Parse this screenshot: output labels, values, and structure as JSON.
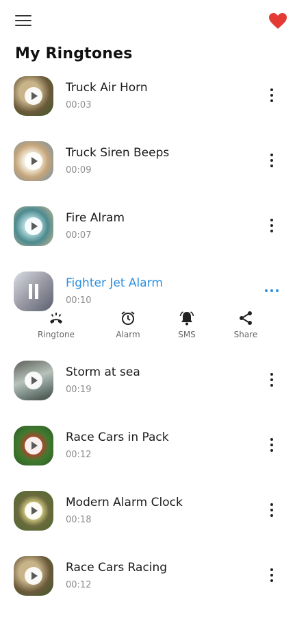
{
  "header": {
    "menu_icon": "hamburger-menu-icon",
    "favorite_icon": "heart-icon",
    "title": "My Ringtones",
    "colors": {
      "heart": "#e53935",
      "accent": "#2b8fe0"
    }
  },
  "ringtones": [
    {
      "title": "Truck Air Horn",
      "duration": "00:03",
      "thumb": "#6b5a3a"
    },
    {
      "title": "Truck Siren Beeps",
      "duration": "00:09",
      "thumb": "#c6a57a"
    },
    {
      "title": "Fire Alram",
      "duration": "00:07",
      "thumb": "#4d8a8f"
    },
    {
      "title": "Fighter Jet Alarm",
      "duration": "00:10",
      "thumb": "#9a9aa5",
      "active": true
    },
    {
      "title": "Storm at sea",
      "duration": "00:19",
      "thumb": "#7c8b86"
    },
    {
      "title": "Race Cars in Pack",
      "duration": "00:12",
      "thumb": "#3f7a2f"
    },
    {
      "title": "Modern Alarm Clock",
      "duration": "00:18",
      "thumb": "#6b6a3d"
    },
    {
      "title": "Race Cars Racing",
      "duration": "00:12",
      "thumb": "#6b5a3a"
    }
  ],
  "actions": {
    "ringtone": {
      "label": "Ringtone",
      "icon": "phone-ring-icon"
    },
    "alarm": {
      "label": "Alarm",
      "icon": "alarm-clock-icon"
    },
    "sms": {
      "label": "SMS",
      "icon": "bell-icon"
    },
    "share": {
      "label": "Share",
      "icon": "share-icon"
    }
  }
}
